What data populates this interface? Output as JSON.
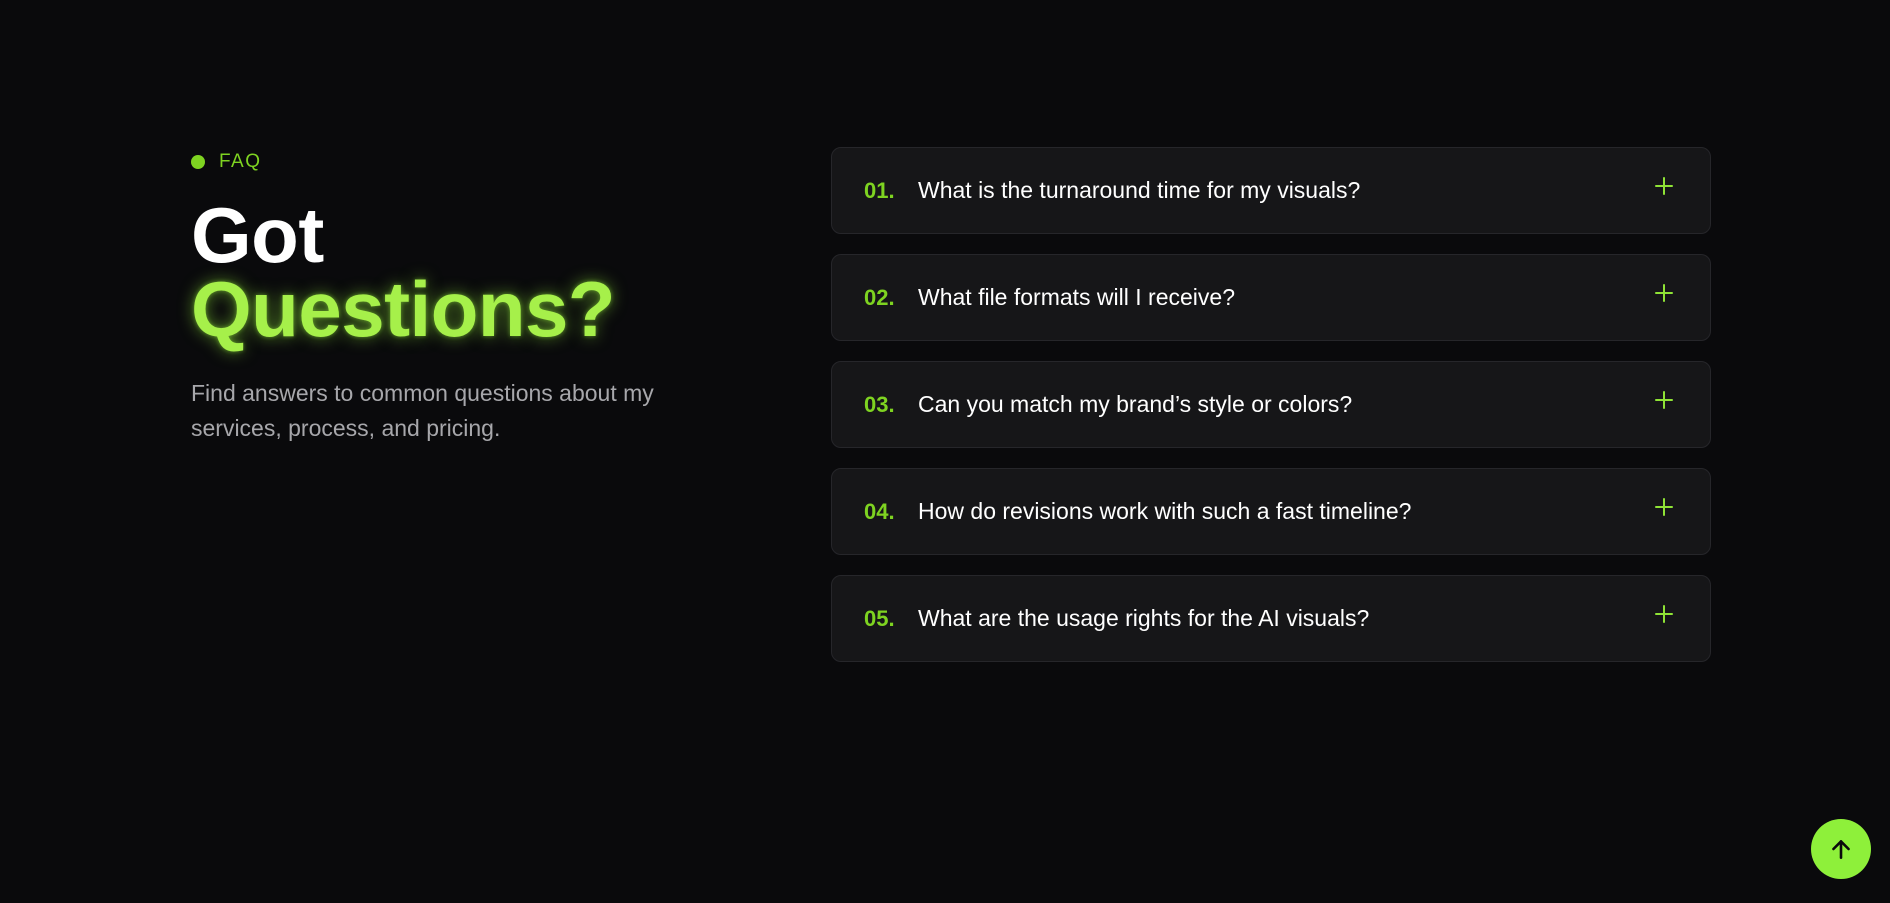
{
  "faq_section": {
    "eyebrow": "FAQ",
    "heading_line1": "Got",
    "heading_line2": "Questions?",
    "subtitle": "Find answers to common questions about my services, process, and pricing.",
    "items": [
      {
        "number": "01.",
        "question": "What is the turnaround time for my visuals?",
        "icon": "plus-icon"
      },
      {
        "number": "02.",
        "question": "What file formats will I receive?",
        "icon": "plus-icon"
      },
      {
        "number": "03.",
        "question": "Can you match my brand’s style or colors?",
        "icon": "plus-icon"
      },
      {
        "number": "04.",
        "question": "How do revisions work with such a fast timeline?",
        "icon": "plus-icon"
      },
      {
        "number": "05.",
        "question": "What are the usage rights for the AI visuals?",
        "icon": "plus-icon"
      }
    ]
  },
  "scroll_top": {
    "icon": "arrow-up-icon"
  },
  "colors": {
    "background": "#0a0a0c",
    "accent": "#7ed321",
    "accent_glow": "#a6f04a",
    "card": "#161618",
    "button": "#8ef03a"
  }
}
